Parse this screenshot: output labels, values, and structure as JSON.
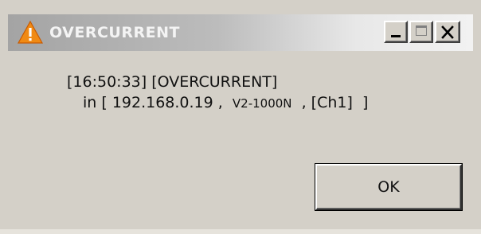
{
  "window": {
    "title": "OVERCURRENT",
    "title_icon": "warning-icon",
    "controls": {
      "minimize_icon": "minimize-icon",
      "maximize_icon": "maximize-icon",
      "close_icon": "close-icon"
    }
  },
  "message": {
    "line1": "[16:50:33] [OVERCURRENT]",
    "line2_prefix": "in [ 192.168.0.19 ,  ",
    "model": "V2-1000N",
    "line2_suffix": "  , [Ch1]  ]"
  },
  "buttons": {
    "ok_label": "OK"
  },
  "colors": {
    "dialog_face": "#d4d0c8",
    "title_text": "#f4f4f4",
    "warning_fill": "#f08a14"
  }
}
